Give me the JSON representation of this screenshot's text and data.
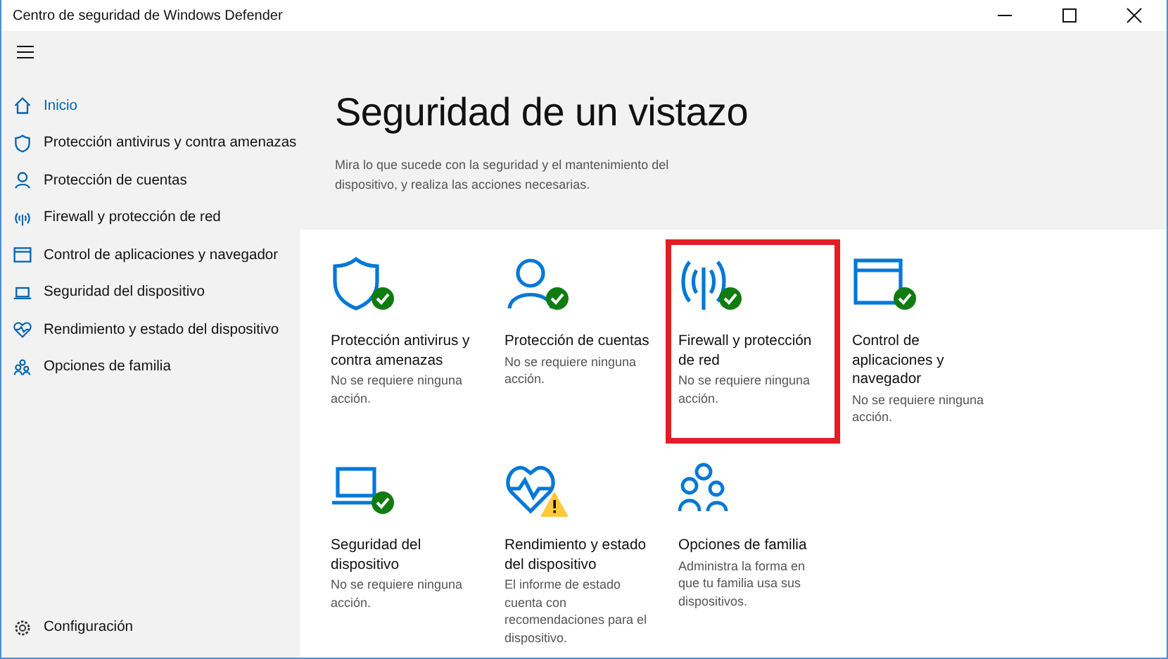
{
  "window": {
    "title": "Centro de seguridad de Windows Defender"
  },
  "sidebar": {
    "items": [
      {
        "label": "Inicio",
        "selected": true
      },
      {
        "label": "Protección antivirus y contra amenazas",
        "selected": false
      },
      {
        "label": "Protección de cuentas",
        "selected": false
      },
      {
        "label": "Firewall y protección de red",
        "selected": false
      },
      {
        "label": "Control de aplicaciones y navegador",
        "selected": false
      },
      {
        "label": "Seguridad del dispositivo",
        "selected": false
      },
      {
        "label": "Rendimiento y estado del dispositivo",
        "selected": false
      },
      {
        "label": "Opciones de familia",
        "selected": false
      }
    ],
    "settings": {
      "label": "Configuración"
    }
  },
  "header": {
    "title": "Seguridad de un vistazo",
    "subtitle": "Mira lo que sucede con la seguridad y el mantenimiento del dispositivo, y realiza las acciones necesarias."
  },
  "tiles": [
    {
      "title": "Protección antivirus y contra amenazas",
      "status": "No se requiere ninguna acción.",
      "kind": "ok",
      "highlighted": false
    },
    {
      "title": "Protección de cuentas",
      "status": "No se requiere ninguna acción.",
      "kind": "ok",
      "highlighted": false
    },
    {
      "title": "Firewall y protección de red",
      "status": "No se requiere ninguna acción.",
      "kind": "ok",
      "highlighted": true
    },
    {
      "title": "Control de aplicaciones y navegador",
      "status": "No se requiere ninguna acción.",
      "kind": "ok",
      "highlighted": false
    },
    {
      "title": "Seguridad del dispositivo",
      "status": "No se requiere ninguna acción.",
      "kind": "ok",
      "highlighted": false
    },
    {
      "title": "Rendimiento y estado del dispositivo",
      "status": "El informe de estado cuenta con recomendaciones para el dispositivo.",
      "kind": "warning",
      "highlighted": false
    },
    {
      "title": "Opciones de familia",
      "status": "Administra la forma en que tu familia usa sus dispositivos.",
      "kind": "plain",
      "highlighted": false
    }
  ]
}
